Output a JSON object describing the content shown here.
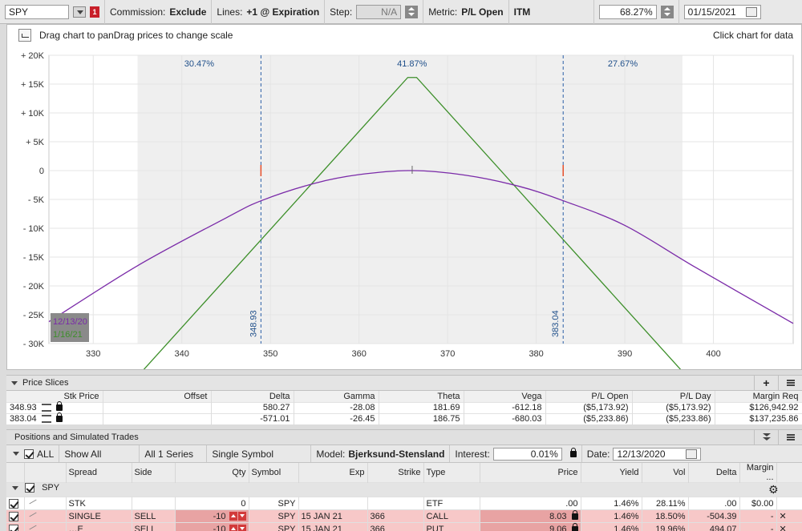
{
  "toolbar": {
    "symbol": "SPY",
    "alert_badge": "1",
    "commission_label": "Commission:",
    "commission_value": "Exclude",
    "lines_label": "Lines:",
    "lines_value": "+1 @ Expiration",
    "step_label": "Step:",
    "step_value": "N/A",
    "metric_label": "Metric:",
    "metric_value": "P/L Open",
    "itm_value": "ITM",
    "probability": "68.27%",
    "date": "01/15/2021"
  },
  "chart": {
    "hint_left": "Drag chart to panDrag prices to change scale",
    "hint_right": "Click chart for data"
  },
  "chart_data": {
    "type": "line",
    "x_range": [
      325,
      409
    ],
    "y_range": [
      -30000,
      20000
    ],
    "x_ticks": [
      "330",
      "340",
      "350",
      "360",
      "370",
      "380",
      "390",
      "400"
    ],
    "x_tick_values": [
      330,
      340,
      350,
      360,
      370,
      380,
      390,
      400
    ],
    "y_ticks": [
      "+ 20K",
      "+ 15K",
      "+ 10K",
      "+ 5K",
      "0",
      "- 5K",
      "- 10K",
      "- 15K",
      "- 20K",
      "- 25K",
      "- 30K"
    ],
    "y_tick_values": [
      20000,
      15000,
      10000,
      5000,
      0,
      -5000,
      -10000,
      -15000,
      -20000,
      -25000,
      -30000
    ],
    "breakevens": [
      {
        "label": "348.93",
        "value": 348.93
      },
      {
        "label": "383.04",
        "value": 383.04
      }
    ],
    "zones": [
      {
        "label": "30.47%",
        "from": 335,
        "to": 348.93
      },
      {
        "label": "41.87%",
        "from": 348.93,
        "to": 383.04
      },
      {
        "label": "27.67%",
        "from": 383.04,
        "to": 396.5
      }
    ],
    "series": [
      {
        "name": "1/16/21",
        "color": "#3d8f2a",
        "kind": "expiration",
        "peak_x": 366,
        "peak_y": 17000,
        "left_slope": 1700,
        "right_slope": -1700
      },
      {
        "name": "12/13/20",
        "color": "#7a2aa8",
        "kind": "today",
        "points": [
          [
            325,
            -26200
          ],
          [
            335,
            -16500
          ],
          [
            345,
            -8200
          ],
          [
            349,
            -5200
          ],
          [
            355,
            -2200
          ],
          [
            360,
            -700
          ],
          [
            366,
            0
          ],
          [
            372,
            -800
          ],
          [
            378,
            -2700
          ],
          [
            383,
            -5200
          ],
          [
            390,
            -9500
          ],
          [
            398,
            -16800
          ],
          [
            409,
            -26500
          ]
        ]
      }
    ]
  },
  "price_slices": {
    "title": "Price Slices",
    "columns": [
      "Stk Price",
      "Offset",
      "Delta",
      "Gamma",
      "Theta",
      "Vega",
      "P/L Open",
      "P/L Day",
      "Margin Req"
    ],
    "rows": [
      [
        "348.93",
        "",
        "580.27",
        "-28.08",
        "181.69",
        "-612.18",
        "($5,173.92)",
        "($5,173.92)",
        "$126,942.92"
      ],
      [
        "383.04",
        "",
        "-571.01",
        "-26.45",
        "186.75",
        "-680.03",
        "($5,233.86)",
        "($5,233.86)",
        "$137,235.86"
      ]
    ]
  },
  "positions": {
    "title": "Positions and Simulated Trades",
    "all_label": "ALL",
    "show_all": "Show All",
    "series_filter": "All 1 Series",
    "symbol_filter": "Single Symbol",
    "model_label": "Model:",
    "model_value": "Bjerksund-Stensland",
    "interest_label": "Interest:",
    "interest_value": "0.01%",
    "date_label": "Date:",
    "date_value": "12/13/2020",
    "columns": [
      "Spread",
      "Side",
      "Qty",
      "Symbol",
      "Exp",
      "Strike",
      "Type",
      "Price",
      "Yield",
      "Vol",
      "Delta",
      "Margin ..."
    ],
    "group": "SPY",
    "rows": [
      {
        "spread": "STK",
        "side": "",
        "qty": "0",
        "symbol": "SPY",
        "exp": "",
        "strike": "",
        "type": "ETF",
        "price": ".00",
        "yield": "1.46%",
        "vol": "28.11%",
        "delta": ".00",
        "margin": "$0.00",
        "kind": "stk"
      },
      {
        "spread": "SINGLE",
        "side": "SELL",
        "qty": "-10",
        "symbol": "SPY",
        "exp": "15 JAN 21",
        "strike": "366",
        "type": "CALL",
        "price": "8.03",
        "yield": "1.46%",
        "vol": "18.50%",
        "delta": "-504.39",
        "margin": "-",
        "kind": "sell"
      },
      {
        "spread": "…E",
        "side": "SELL",
        "qty": "-10",
        "symbol": "SPY",
        "exp": "15 JAN 21",
        "strike": "366",
        "type": "PUT",
        "price": "9.06",
        "yield": "1.46%",
        "vol": "19.96%",
        "delta": "494.07",
        "margin": "-",
        "kind": "sell"
      }
    ]
  }
}
